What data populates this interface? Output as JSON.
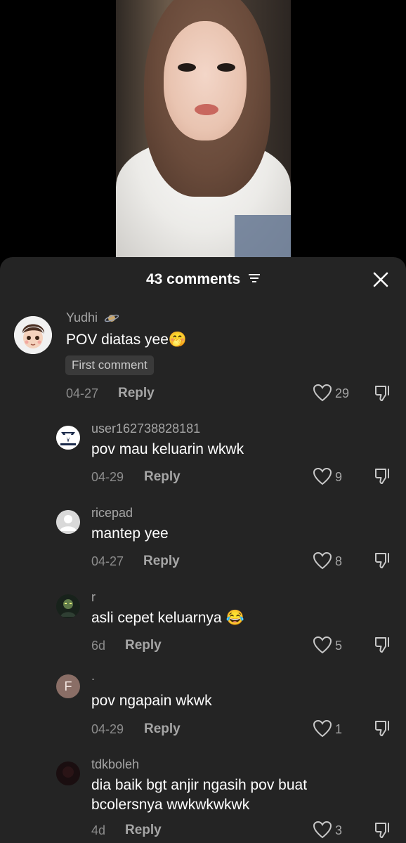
{
  "sheet": {
    "title": "43 comments"
  },
  "comments": [
    {
      "username": "Yudhi",
      "text": "POV diatas yee🤭",
      "badge": "First comment",
      "date": "04-27",
      "reply_label": "Reply",
      "likes": "29"
    },
    {
      "username": "user162738828181",
      "text": "pov mau keluarin wkwk",
      "date": "04-29",
      "reply_label": "Reply",
      "likes": "9"
    },
    {
      "username": "ricepad",
      "text": "mantep yee",
      "date": "04-27",
      "reply_label": "Reply",
      "likes": "8"
    },
    {
      "username": "r",
      "text": "asli cepet keluarnya 😂",
      "date": "6d",
      "reply_label": "Reply",
      "likes": "5"
    },
    {
      "username": ".",
      "avatar_letter": "F",
      "text": "pov ngapain wkwk",
      "date": "04-29",
      "reply_label": "Reply",
      "likes": "1"
    },
    {
      "username": "tdkboleh",
      "text_line1": "dia baik bgt anjir ngasih pov buat",
      "text_line2": "bcolersnya wwkwkwkwk",
      "date": "4d",
      "reply_label": "Reply",
      "likes": "3"
    }
  ],
  "colors": {
    "sheet_bg": "#242424",
    "secondary_text": "#a6a6a6",
    "avatar_f_bg": "#8a6e66"
  }
}
